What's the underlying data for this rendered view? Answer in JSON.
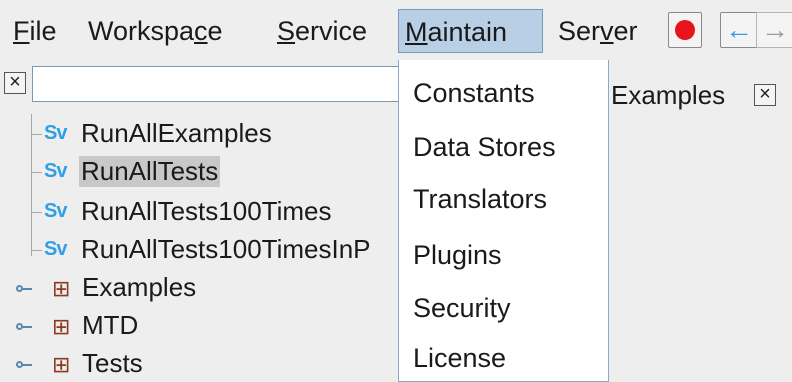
{
  "menubar": {
    "items": [
      {
        "mnemonic": "F",
        "rest": "ile"
      },
      {
        "pre": "Workspa",
        "mnemonic": "c",
        "rest": "e"
      },
      {
        "mnemonic": "S",
        "rest": "ervice"
      },
      {
        "mnemonic": "M",
        "rest": "aintain"
      },
      {
        "pre": "Ser",
        "mnemonic": "v",
        "rest": "er"
      }
    ],
    "stop_icon": "stop-icon",
    "back_arrow": "←",
    "forward_arrow": "→",
    "colors": {
      "accent_open": "#b8cfe5",
      "stop": "#e8141b",
      "arrow_active": "#2f9fe6",
      "arrow_inactive": "#9a9a9a"
    }
  },
  "filter": {
    "close_glyph": "×",
    "value": ""
  },
  "tab": {
    "label": "Examples",
    "close_glyph": "×"
  },
  "tree": {
    "items": [
      {
        "icon_text": "Sv",
        "label": "RunAllExamples",
        "selected": false
      },
      {
        "icon_text": "Sv",
        "label": "RunAllTests",
        "selected": true
      },
      {
        "icon_text": "Sv",
        "label": "RunAllTests100Times",
        "selected": false
      },
      {
        "icon_text": "Sv",
        "label": "RunAllTests100TimesInP",
        "selected": false
      }
    ],
    "folders": [
      {
        "icon": "⊞",
        "label": "Examples"
      },
      {
        "icon": "⊞",
        "label": "MTD"
      },
      {
        "icon": "⊞",
        "label": "Tests"
      }
    ]
  },
  "dropdown": {
    "items": [
      "Constants",
      "Data Stores",
      "Translators",
      "Plugins",
      "Security",
      "License"
    ]
  }
}
